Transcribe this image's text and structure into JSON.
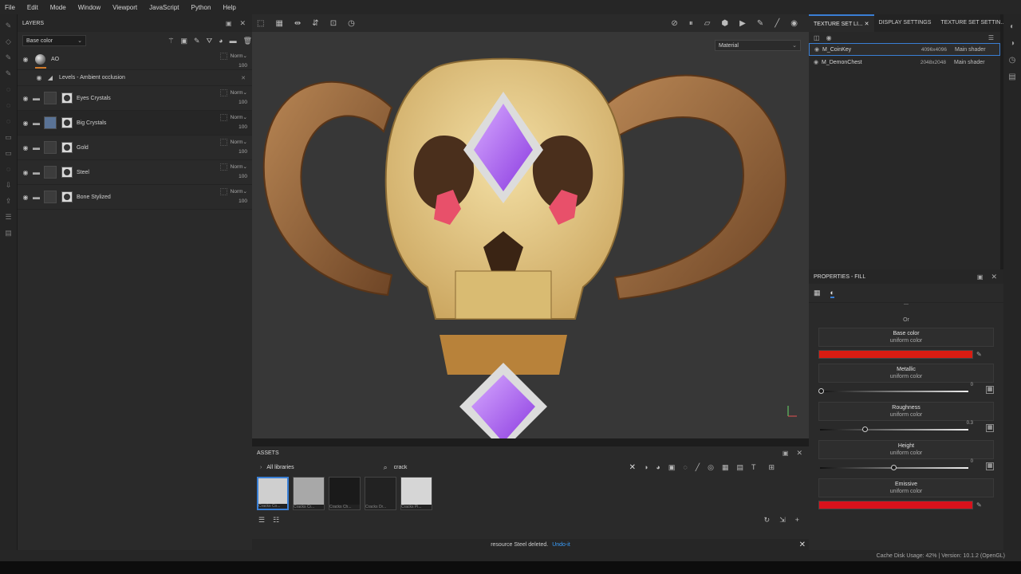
{
  "menu": [
    "File",
    "Edit",
    "Mode",
    "Window",
    "Viewport",
    "JavaScript",
    "Python",
    "Help"
  ],
  "layers": {
    "title": "LAYERS",
    "blend_channel": "Base color",
    "ao": {
      "name": "AO",
      "blend": "Norm",
      "opacity": "100"
    },
    "sub": {
      "name": "Levels - Ambient occlusion"
    },
    "items": [
      {
        "name": "Eyes Crystals",
        "blend": "Norm",
        "opacity": "100"
      },
      {
        "name": "Big Crystals",
        "blend": "Norm",
        "opacity": "100"
      },
      {
        "name": "Gold",
        "blend": "Norm",
        "opacity": "100"
      },
      {
        "name": "Steel",
        "blend": "Norm",
        "opacity": "100"
      },
      {
        "name": "Bone Stylized",
        "blend": "Norm",
        "opacity": "100"
      }
    ]
  },
  "viewport": {
    "material_mode": "Material"
  },
  "texture_sets": {
    "tabs": [
      "TEXTURE SET LI...",
      "DISPLAY SETTINGS",
      "TEXTURE SET SETTIN..."
    ],
    "rows": [
      {
        "name": "M_CoinKey",
        "size": "4096x4096",
        "shader": "Main shader"
      },
      {
        "name": "M_DemonChest",
        "size": "2048x2048",
        "shader": "Main shader"
      }
    ]
  },
  "properties": {
    "title": "PROPERTIES - FILL",
    "or_label": "Or",
    "channels": [
      {
        "name": "Base color",
        "sub": "uniform color",
        "color": "#d91c12"
      },
      {
        "name": "Metallic",
        "sub": "uniform color",
        "value": "0",
        "level": 0
      },
      {
        "name": "Roughness",
        "sub": "uniform color",
        "value": "0.3",
        "level": 0.3
      },
      {
        "name": "Height",
        "sub": "uniform color",
        "value": "0",
        "level": 0.5
      },
      {
        "name": "Emissive",
        "sub": "uniform color",
        "color": "#d9121c"
      }
    ]
  },
  "assets": {
    "title": "ASSETS",
    "library": "All libraries",
    "search_value": "crack",
    "thumbs": [
      {
        "caption": "Cracks Co..."
      },
      {
        "caption": "Cracks Cr..."
      },
      {
        "caption": "Cracks Ch..."
      },
      {
        "caption": "Cracks Dr..."
      },
      {
        "caption": "Cracks Pi..."
      }
    ]
  },
  "status": {
    "message": "resource Steel deleted.",
    "undo": "Undo-it"
  },
  "footer": {
    "text": "Cache Disk Usage:  42% | Version: 10.1.2 (OpenGL)"
  },
  "colors": {
    "accent": "#3a7fd5",
    "bone": "#e6c987",
    "horn": "#9a6a3e",
    "crystal": "#a560e8",
    "eye": "#e8506a"
  }
}
